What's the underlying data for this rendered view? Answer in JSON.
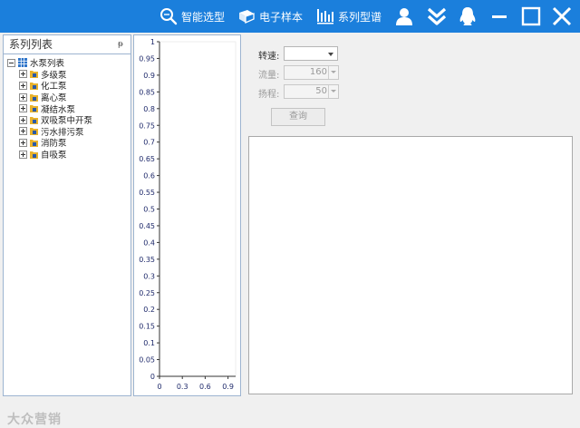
{
  "toolbar": {
    "smart_select": "智能选型",
    "e_sample": "电子样本",
    "series_spectrum": "系列型谱"
  },
  "left_panel": {
    "title": "系列列表",
    "pin": "ᵽ",
    "root": "水泵列表",
    "items": [
      "多级泵",
      "化工泵",
      "离心泵",
      "凝结水泵",
      "双吸泵中开泵",
      "污水排污泵",
      "消防泵",
      "自吸泵"
    ]
  },
  "watermark": "大众营销",
  "chart_data": {
    "type": "line",
    "x_ticks": [
      "0",
      "0.3",
      "0.6",
      "0.9"
    ],
    "y_ticks": [
      "0",
      "0.05",
      "0.1",
      "0.15",
      "0.2",
      "0.25",
      "0.3",
      "0.35",
      "0.4",
      "0.45",
      "0.5",
      "0.55",
      "0.6",
      "0.65",
      "0.7",
      "0.75",
      "0.8",
      "0.85",
      "0.9",
      "0.95",
      "1"
    ],
    "xlim": [
      0,
      1
    ],
    "ylim": [
      0,
      1
    ],
    "series": []
  },
  "form": {
    "speed_label": "转速:",
    "speed_value": "",
    "flow_label": "流量:",
    "flow_value": "160",
    "head_label": "扬程:",
    "head_value": "50",
    "query_label": "查询"
  },
  "colors": {
    "titlebar": "#1b7fdc",
    "border": "#9db4d0",
    "tick_text": "#1f2a6b"
  }
}
